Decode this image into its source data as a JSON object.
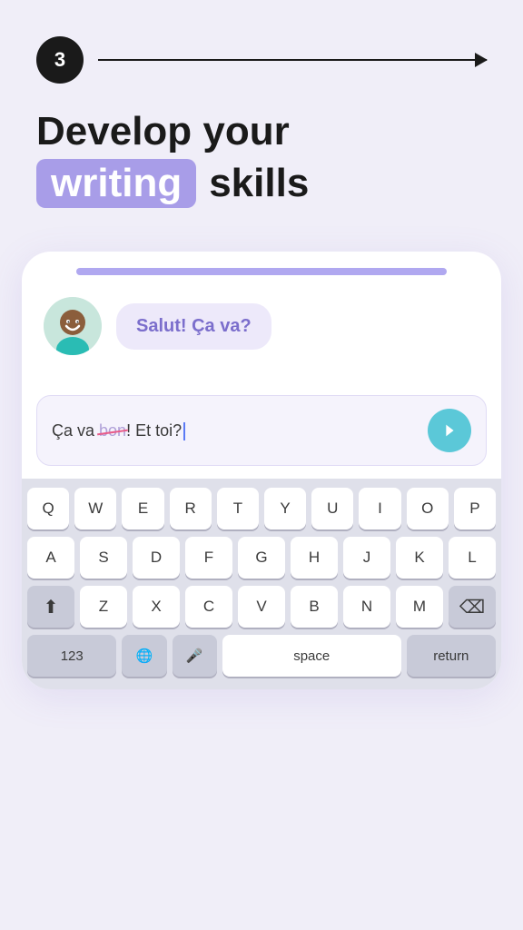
{
  "step": {
    "number": "3"
  },
  "headline": {
    "line1": "Develop your",
    "highlighted": "writing",
    "line2_rest": "skills"
  },
  "chat": {
    "message": "Salut! Ça va?"
  },
  "input": {
    "prefix": "Ça va ",
    "strikethrough": "bon",
    "suffix": "! Et toi?"
  },
  "keyboard": {
    "row1": [
      "Q",
      "W",
      "E",
      "R",
      "T",
      "Y",
      "U",
      "I",
      "O",
      "P"
    ],
    "row2": [
      "A",
      "S",
      "D",
      "F",
      "G",
      "H",
      "J",
      "K",
      "L"
    ],
    "row3": [
      "Z",
      "X",
      "C",
      "V",
      "B",
      "N",
      "M"
    ],
    "bottom": {
      "numbers": "123",
      "globe": "🌐",
      "mic": "🎤",
      "space": "space",
      "return": "return"
    }
  }
}
